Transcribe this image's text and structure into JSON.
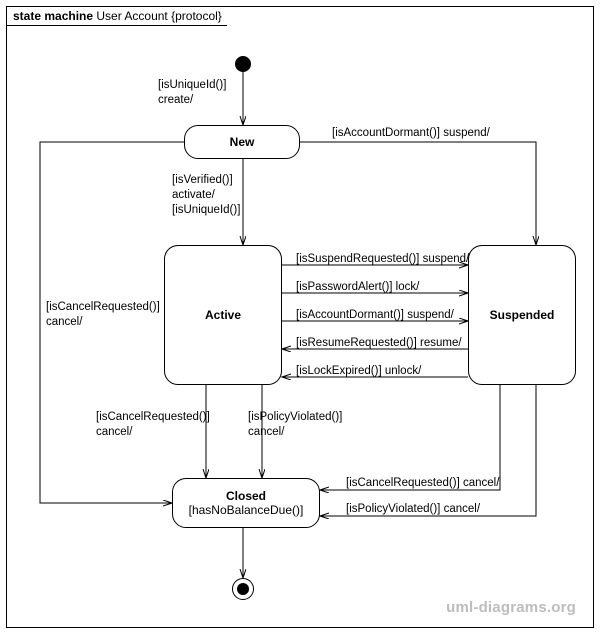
{
  "frame": {
    "keyword": "state machine",
    "title": "User Account {protocol}"
  },
  "states": {
    "new": {
      "name": "New"
    },
    "active": {
      "name": "Active"
    },
    "suspended": {
      "name": "Suspended"
    },
    "closed": {
      "name": "Closed",
      "invariant": "[hasNoBalanceDue()]"
    }
  },
  "transitions": {
    "initial_to_new_g": "[isUniqueId()]",
    "initial_to_new_a": "create/",
    "new_to_active_g1": "[isVerified()]",
    "new_to_active_a": "activate/",
    "new_to_active_g2": "[isUniqueId()]",
    "new_to_suspended": "[isAccountDormant()] suspend/",
    "new_to_closed_g": "[isCancelRequested()]",
    "new_to_closed_a": "cancel/",
    "active_to_susp_1": "[isSuspendRequested()] suspend/",
    "active_to_susp_2": "[isPasswordAlert()] lock/",
    "active_to_susp_3": "[isAccountDormant()] suspend/",
    "susp_to_active_1": "[isResumeRequested()] resume/",
    "susp_to_active_2": "[isLockExpired()] unlock/",
    "active_to_closed_1_g": "[isCancelRequested()]",
    "active_to_closed_1_a": "cancel/",
    "active_to_closed_2_g": "[isPolicyViolated()]",
    "active_to_closed_2_a": "cancel/",
    "susp_to_closed_1": "[isCancelRequested()] cancel/",
    "susp_to_closed_2": "[isPolicyViolated()] cancel/"
  },
  "watermark": "uml-diagrams.org"
}
